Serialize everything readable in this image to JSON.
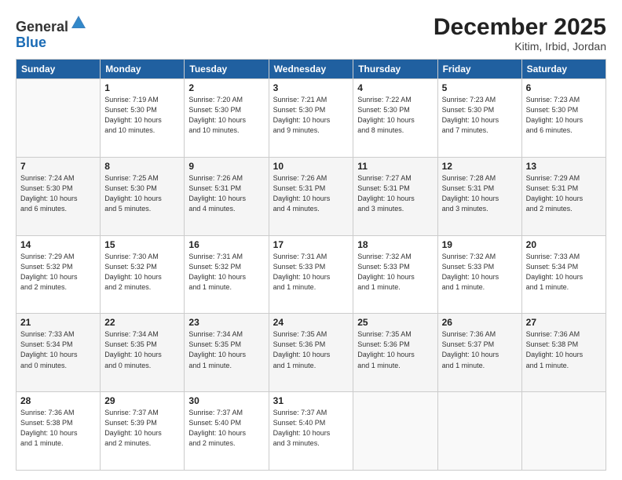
{
  "header": {
    "logo_general": "General",
    "logo_blue": "Blue",
    "month_title": "December 2025",
    "location": "Kitim, Irbid, Jordan"
  },
  "weekdays": [
    "Sunday",
    "Monday",
    "Tuesday",
    "Wednesday",
    "Thursday",
    "Friday",
    "Saturday"
  ],
  "weeks": [
    [
      {
        "day": "",
        "info": ""
      },
      {
        "day": "1",
        "info": "Sunrise: 7:19 AM\nSunset: 5:30 PM\nDaylight: 10 hours\nand 10 minutes."
      },
      {
        "day": "2",
        "info": "Sunrise: 7:20 AM\nSunset: 5:30 PM\nDaylight: 10 hours\nand 10 minutes."
      },
      {
        "day": "3",
        "info": "Sunrise: 7:21 AM\nSunset: 5:30 PM\nDaylight: 10 hours\nand 9 minutes."
      },
      {
        "day": "4",
        "info": "Sunrise: 7:22 AM\nSunset: 5:30 PM\nDaylight: 10 hours\nand 8 minutes."
      },
      {
        "day": "5",
        "info": "Sunrise: 7:23 AM\nSunset: 5:30 PM\nDaylight: 10 hours\nand 7 minutes."
      },
      {
        "day": "6",
        "info": "Sunrise: 7:23 AM\nSunset: 5:30 PM\nDaylight: 10 hours\nand 6 minutes."
      }
    ],
    [
      {
        "day": "7",
        "info": "Sunrise: 7:24 AM\nSunset: 5:30 PM\nDaylight: 10 hours\nand 6 minutes."
      },
      {
        "day": "8",
        "info": "Sunrise: 7:25 AM\nSunset: 5:30 PM\nDaylight: 10 hours\nand 5 minutes."
      },
      {
        "day": "9",
        "info": "Sunrise: 7:26 AM\nSunset: 5:31 PM\nDaylight: 10 hours\nand 4 minutes."
      },
      {
        "day": "10",
        "info": "Sunrise: 7:26 AM\nSunset: 5:31 PM\nDaylight: 10 hours\nand 4 minutes."
      },
      {
        "day": "11",
        "info": "Sunrise: 7:27 AM\nSunset: 5:31 PM\nDaylight: 10 hours\nand 3 minutes."
      },
      {
        "day": "12",
        "info": "Sunrise: 7:28 AM\nSunset: 5:31 PM\nDaylight: 10 hours\nand 3 minutes."
      },
      {
        "day": "13",
        "info": "Sunrise: 7:29 AM\nSunset: 5:31 PM\nDaylight: 10 hours\nand 2 minutes."
      }
    ],
    [
      {
        "day": "14",
        "info": "Sunrise: 7:29 AM\nSunset: 5:32 PM\nDaylight: 10 hours\nand 2 minutes."
      },
      {
        "day": "15",
        "info": "Sunrise: 7:30 AM\nSunset: 5:32 PM\nDaylight: 10 hours\nand 2 minutes."
      },
      {
        "day": "16",
        "info": "Sunrise: 7:31 AM\nSunset: 5:32 PM\nDaylight: 10 hours\nand 1 minute."
      },
      {
        "day": "17",
        "info": "Sunrise: 7:31 AM\nSunset: 5:33 PM\nDaylight: 10 hours\nand 1 minute."
      },
      {
        "day": "18",
        "info": "Sunrise: 7:32 AM\nSunset: 5:33 PM\nDaylight: 10 hours\nand 1 minute."
      },
      {
        "day": "19",
        "info": "Sunrise: 7:32 AM\nSunset: 5:33 PM\nDaylight: 10 hours\nand 1 minute."
      },
      {
        "day": "20",
        "info": "Sunrise: 7:33 AM\nSunset: 5:34 PM\nDaylight: 10 hours\nand 1 minute."
      }
    ],
    [
      {
        "day": "21",
        "info": "Sunrise: 7:33 AM\nSunset: 5:34 PM\nDaylight: 10 hours\nand 0 minutes."
      },
      {
        "day": "22",
        "info": "Sunrise: 7:34 AM\nSunset: 5:35 PM\nDaylight: 10 hours\nand 0 minutes."
      },
      {
        "day": "23",
        "info": "Sunrise: 7:34 AM\nSunset: 5:35 PM\nDaylight: 10 hours\nand 1 minute."
      },
      {
        "day": "24",
        "info": "Sunrise: 7:35 AM\nSunset: 5:36 PM\nDaylight: 10 hours\nand 1 minute."
      },
      {
        "day": "25",
        "info": "Sunrise: 7:35 AM\nSunset: 5:36 PM\nDaylight: 10 hours\nand 1 minute."
      },
      {
        "day": "26",
        "info": "Sunrise: 7:36 AM\nSunset: 5:37 PM\nDaylight: 10 hours\nand 1 minute."
      },
      {
        "day": "27",
        "info": "Sunrise: 7:36 AM\nSunset: 5:38 PM\nDaylight: 10 hours\nand 1 minute."
      }
    ],
    [
      {
        "day": "28",
        "info": "Sunrise: 7:36 AM\nSunset: 5:38 PM\nDaylight: 10 hours\nand 1 minute."
      },
      {
        "day": "29",
        "info": "Sunrise: 7:37 AM\nSunset: 5:39 PM\nDaylight: 10 hours\nand 2 minutes."
      },
      {
        "day": "30",
        "info": "Sunrise: 7:37 AM\nSunset: 5:40 PM\nDaylight: 10 hours\nand 2 minutes."
      },
      {
        "day": "31",
        "info": "Sunrise: 7:37 AM\nSunset: 5:40 PM\nDaylight: 10 hours\nand 3 minutes."
      },
      {
        "day": "",
        "info": ""
      },
      {
        "day": "",
        "info": ""
      },
      {
        "day": "",
        "info": ""
      }
    ]
  ]
}
